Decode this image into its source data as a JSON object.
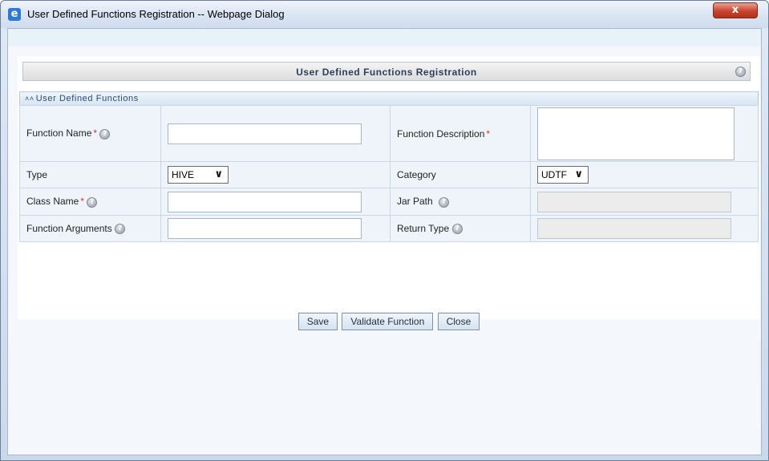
{
  "window": {
    "title": "User Defined Functions Registration -- Webpage Dialog",
    "close_glyph": "x",
    "icon": "ie-icon"
  },
  "page": {
    "header_title": "User Defined Functions Registration",
    "section_title": "User Defined Functions",
    "help_glyph": "?"
  },
  "form": {
    "function_name": {
      "label": "Function Name",
      "required": "*",
      "value": ""
    },
    "function_description": {
      "label": "Function Description",
      "required": "*",
      "value": ""
    },
    "type": {
      "label": "Type",
      "selected": "HIVE"
    },
    "category": {
      "label": "Category",
      "selected": "UDTF"
    },
    "class_name": {
      "label": "Class Name",
      "required": "*",
      "value": ""
    },
    "jar_path": {
      "label": "Jar Path",
      "value": ""
    },
    "function_arguments": {
      "label": "Function Arguments",
      "value": ""
    },
    "return_type": {
      "label": "Return Type",
      "value": ""
    }
  },
  "buttons": {
    "save": "Save",
    "validate": "Validate Function",
    "close": "Close"
  }
}
